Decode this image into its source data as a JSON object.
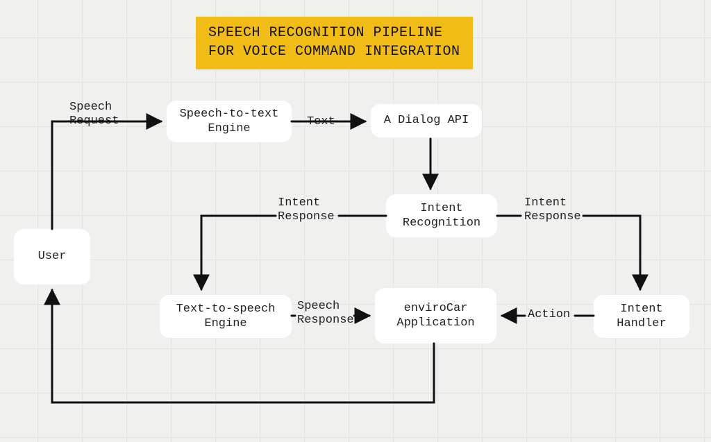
{
  "title": "SPEECH RECOGNITION PIPELINE\nFOR VOICE COMMAND INTEGRATION",
  "nodes": {
    "user": "User",
    "stt": "Speech-to-text\nEngine",
    "dialog": "A Dialog API",
    "intentRecog": "Intent\nRecognition",
    "tts": "Text-to-speech\nEngine",
    "envirocar": "enviroCar\nApplication",
    "intentHandler": "Intent\nHandler"
  },
  "labels": {
    "speechRequest": "Speech\nRequest",
    "text": "Text",
    "intentResponseLeft": "Intent\nResponse",
    "intentResponseRight": "Intent\nResponse",
    "speechResponse": "Speech\nResponse",
    "action": "Action"
  }
}
